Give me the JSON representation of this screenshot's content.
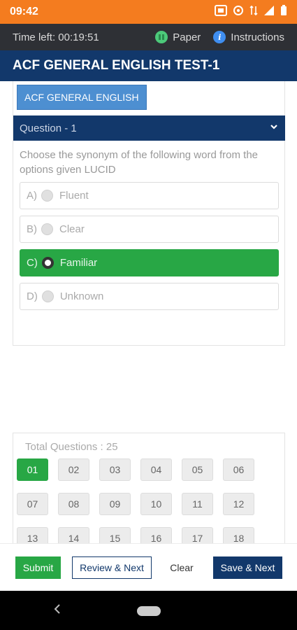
{
  "status_bar": {
    "time": "09:42"
  },
  "top_bar": {
    "time_left": "Time left: 00:19:51",
    "paper_label": "Paper",
    "instructions_label": "Instructions"
  },
  "test_title": "ACF GENERAL ENGLISH TEST-1",
  "section_button": "ACF GENERAL ENGLISH",
  "question": {
    "header": "Question - 1",
    "text": "Choose the synonym of the following word from the options given LUCID",
    "options": [
      {
        "letter": "A)",
        "label": "Fluent",
        "selected": false
      },
      {
        "letter": "B)",
        "label": "Clear",
        "selected": false
      },
      {
        "letter": "C)",
        "label": "Familiar",
        "selected": true
      },
      {
        "letter": "D)",
        "label": "Unknown",
        "selected": false
      }
    ]
  },
  "palette": {
    "total_label": "Total Questions : 25",
    "numbers": [
      "01",
      "02",
      "03",
      "04",
      "05",
      "06",
      "07",
      "08",
      "09",
      "10",
      "11",
      "12",
      "13",
      "14",
      "15",
      "16",
      "17",
      "18"
    ],
    "active": "01"
  },
  "actions": {
    "submit": "Submit",
    "review_next": "Review & Next",
    "clear": "Clear",
    "save_next": "Save & Next"
  },
  "colors": {
    "status_bar": "#f47c1f",
    "nav_blue": "#12386b",
    "selected_green": "#28a745",
    "section_blue": "#4d8fd1"
  }
}
